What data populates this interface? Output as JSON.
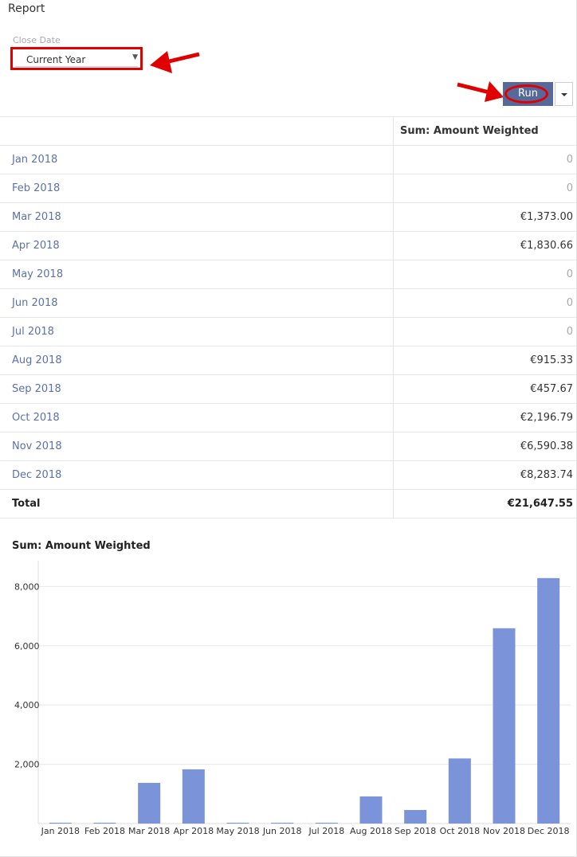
{
  "report": {
    "title": "Report",
    "filter": {
      "label": "Close Date",
      "value": "Current Year"
    },
    "run_label": "Run"
  },
  "table": {
    "header": "Sum: Amount Weighted",
    "rows": [
      {
        "label": "Jan 2018",
        "value": "0"
      },
      {
        "label": "Feb 2018",
        "value": "0"
      },
      {
        "label": "Mar 2018",
        "value": "€1,373.00"
      },
      {
        "label": "Apr 2018",
        "value": "€1,830.66"
      },
      {
        "label": "May 2018",
        "value": "0"
      },
      {
        "label": "Jun 2018",
        "value": "0"
      },
      {
        "label": "Jul 2018",
        "value": "0"
      },
      {
        "label": "Aug 2018",
        "value": "€915.33"
      },
      {
        "label": "Sep 2018",
        "value": "€457.67"
      },
      {
        "label": "Oct 2018",
        "value": "€2,196.79"
      },
      {
        "label": "Nov 2018",
        "value": "€6,590.38"
      },
      {
        "label": "Dec 2018",
        "value": "€8,283.74"
      }
    ],
    "total_label": "Total",
    "total_value": "€21,647.55"
  },
  "chart_data": {
    "type": "bar",
    "title": "Sum: Amount Weighted",
    "categories": [
      "Jan 2018",
      "Feb 2018",
      "Mar 2018",
      "Apr 2018",
      "May 2018",
      "Jun 2018",
      "Jul 2018",
      "Aug 2018",
      "Sep 2018",
      "Oct 2018",
      "Nov 2018",
      "Dec 2018"
    ],
    "values": [
      0,
      0,
      1373.0,
      1830.66,
      0,
      0,
      0,
      915.33,
      457.67,
      2196.79,
      6590.38,
      8283.74
    ],
    "yticks": [
      "2,000",
      "4,000",
      "6,000",
      "8,000"
    ],
    "ylim": [
      0,
      8870
    ],
    "xlabel": "",
    "ylabel": "",
    "grid": true,
    "bar_color": "#7b93d9"
  },
  "colors": {
    "accent": "#56699b",
    "annotation": "#e00000",
    "link": "#5b72a8"
  },
  "icons": {
    "select_caret": "▼",
    "run_dropdown": "caret-down-icon"
  }
}
